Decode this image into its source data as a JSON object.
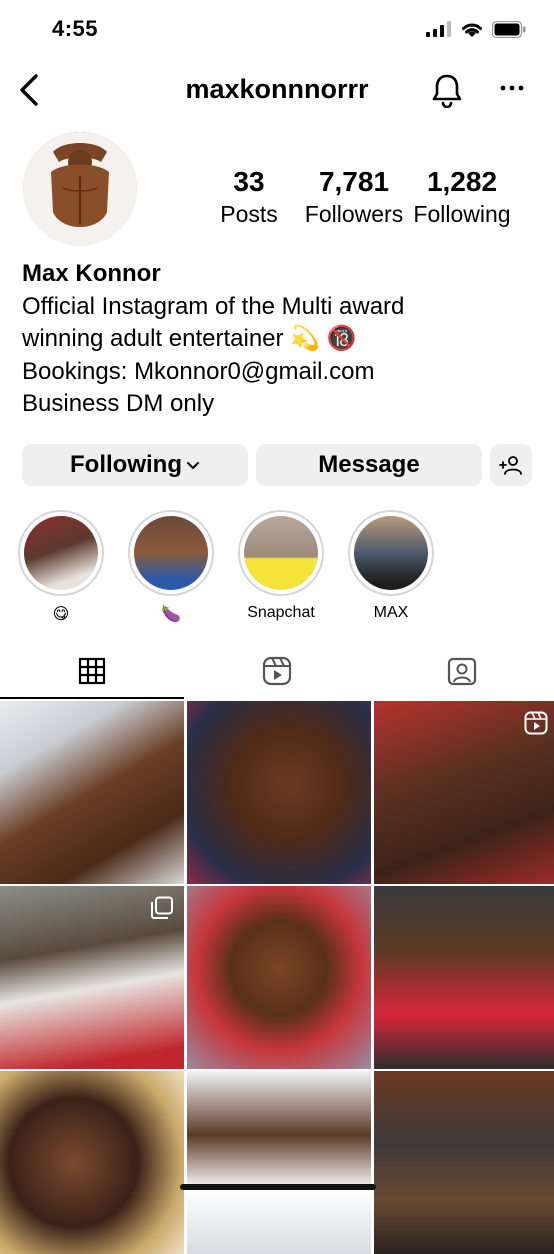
{
  "status_bar": {
    "time": "4:55"
  },
  "header": {
    "username": "maxkonnnorrr"
  },
  "profile": {
    "stats": [
      {
        "value": "33",
        "label": "Posts"
      },
      {
        "value": "7,781",
        "label": "Followers"
      },
      {
        "value": "1,282",
        "label": "Following"
      }
    ],
    "name": "Max Konnor",
    "bio_lines": [
      "Official Instagram of the Multi award",
      "winning adult entertainer 💫 🔞",
      "Bookings: Mkonnor0@gmail.com",
      "Business DM only"
    ]
  },
  "actions": {
    "following_label": "Following",
    "message_label": "Message"
  },
  "highlights": [
    {
      "label": "😋"
    },
    {
      "label": "🍆"
    },
    {
      "label": "Snapchat"
    },
    {
      "label": "MAX"
    }
  ],
  "tabs": [
    "posts-grid",
    "reels",
    "tagged"
  ],
  "colors": {
    "button_bg": "#efefef",
    "text": "#000000",
    "ring": "#d6d6d6"
  }
}
